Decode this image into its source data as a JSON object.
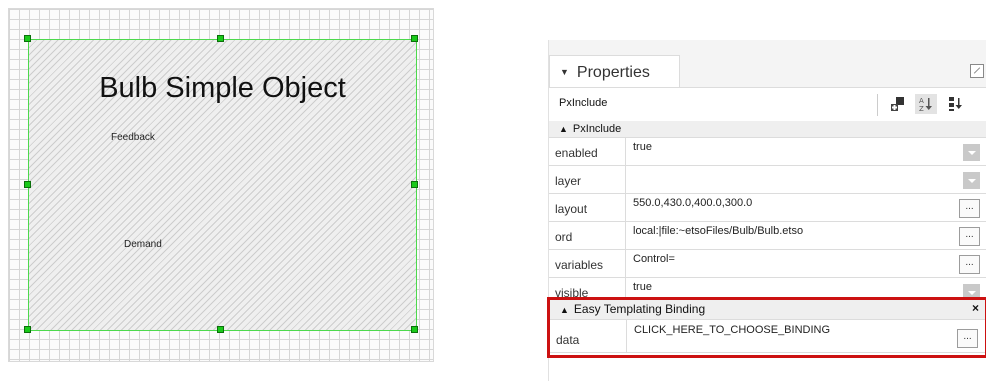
{
  "canvas": {
    "title": "Bulb Simple Object",
    "labels": [
      "Feedback",
      "Demand"
    ]
  },
  "panel": {
    "tab_label": "Properties",
    "object_name": "PxInclude",
    "section_title": "PxInclude",
    "rows": [
      {
        "key": "enabled",
        "value": "true",
        "control": "dropdown"
      },
      {
        "key": "layer",
        "value": "",
        "control": "dropdown"
      },
      {
        "key": "layout",
        "value": "550.0,430.0,400.0,300.0",
        "control": "ellipsis"
      },
      {
        "key": "ord",
        "value": "local:|file:~etsoFiles/Bulb/Bulb.etso",
        "control": "ellipsis"
      },
      {
        "key": "variables",
        "value": "Control=",
        "control": "ellipsis"
      },
      {
        "key": "visible",
        "value": "true",
        "control": "dropdown"
      }
    ],
    "ellipsis_label": "...",
    "binding": {
      "title": "Easy Templating Binding",
      "close_label": "×",
      "key": "data",
      "value": "CLICK_HERE_TO_CHOOSE_BINDING"
    }
  },
  "icons": {
    "collapse_tab": "chevron-down-icon",
    "maximize": "maximize-icon",
    "add_slot": "add-component-icon",
    "sort_alpha": "sort-alpha-icon",
    "sort_order": "sort-order-icon",
    "section_collapse": "collapse-up-icon"
  },
  "colors": {
    "selection_green": "#19c919",
    "highlight_red": "#cc1111"
  }
}
